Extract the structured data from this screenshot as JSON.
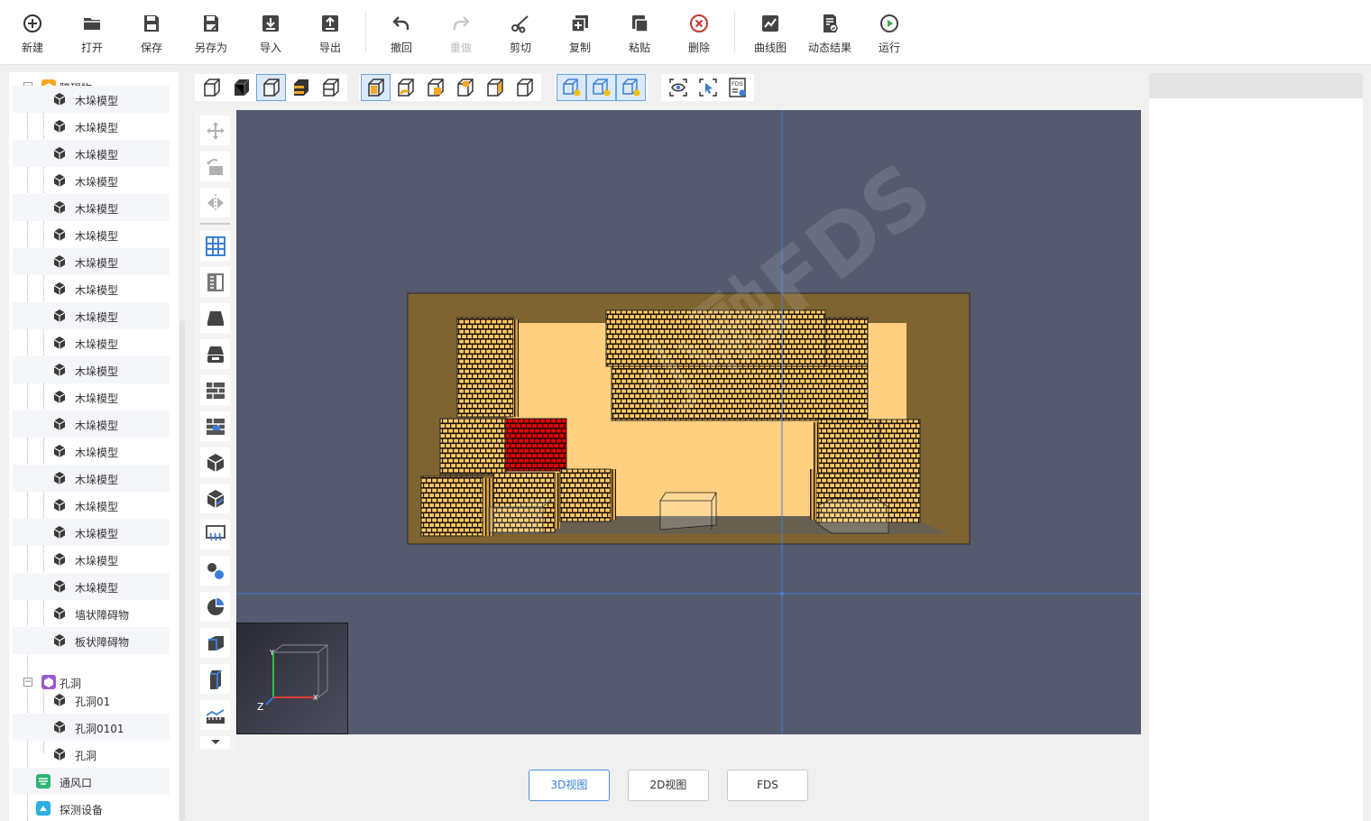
{
  "toolbar": {
    "new": "新建",
    "open": "打开",
    "save": "保存",
    "save_as": "另存为",
    "import": "导入",
    "export": "导出",
    "undo": "撤回",
    "redo": "重做",
    "cut": "剪切",
    "copy": "复制",
    "paste": "粘贴",
    "delete": "删除",
    "curve": "曲线图",
    "dynamic": "动态结果",
    "run": "运行"
  },
  "tree": {
    "obstacles_label": "障碍物",
    "items": [
      "木垛模型",
      "木垛模型",
      "木垛模型",
      "木垛模型",
      "木垛模型",
      "木垛模型",
      "木垛模型",
      "木垛模型",
      "木垛模型",
      "木垛模型",
      "木垛模型",
      "木垛模型",
      "木垛模型",
      "木垛模型",
      "木垛模型",
      "木垛模型",
      "木垛模型",
      "木垛模型",
      "木垛模型"
    ],
    "wall_obstacle": "墙状障碍物",
    "plate_obstacle": "板状障碍物",
    "holes_label": "孔洞",
    "hole_items": [
      "孔洞01",
      "孔洞0101",
      "孔洞"
    ],
    "vent_label": "通风口",
    "detector_label": "探测设备"
  },
  "view_tabs": {
    "view3d": "3D视图",
    "view2d": "2D视图",
    "fds": "FDS"
  },
  "view_toolbar": {
    "fds_badge": "FDS"
  },
  "gizmo": {
    "y": "Y",
    "x": "X",
    "z": "Z"
  },
  "watermark": "小融FDS",
  "colors": {
    "accent": "#3a7fd5",
    "viewport_bg": "#555a6e",
    "wood": "#ffc864",
    "selected": "#e60000",
    "floor": "#7d6430"
  }
}
